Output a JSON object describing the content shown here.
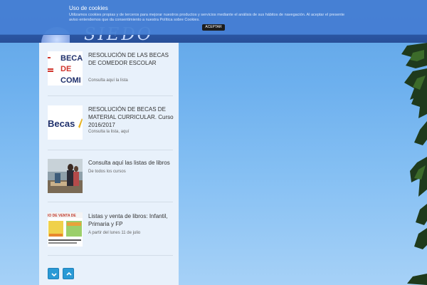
{
  "cookie": {
    "title": "Uso de cookies",
    "text": "Utilizamos cookies propias y de terceros para mejorar nuestros productos y servicios mediante el análisis de sus hábitos de navegación. Al aceptar el presente aviso entendemos que da consentimiento a nuestra Política sobre Cookies.",
    "accept_label": "ACEPTAR"
  },
  "site": {
    "logo_text": "SIEDO"
  },
  "news": [
    {
      "title": "RESOLUCIÓN DE LAS BECAS DE COMEDOR ESCOLAR",
      "subtitle": "Consulta aquí la lista",
      "thumb_lines": [
        "BECAS",
        "DE",
        "COMI"
      ]
    },
    {
      "title": "RESOLUCIÓN DE BECAS DE MATERIAL CURRICULAR. Curso 2016/2017",
      "subtitle": "Consulta la lista, aquí",
      "thumb_text": "Becas"
    },
    {
      "title": "Consulta aquí las listas de libros",
      "subtitle": "De todos los cursos"
    },
    {
      "title": "Listas y venta de libros: Infantil, Primaria y FP",
      "subtitle": "A partir del lunes 11 de julio",
      "thumb_text": "IO DE VENTA DE"
    }
  ],
  "pager": {
    "down_icon": "chevron-down-icon",
    "up_icon": "chevron-up-icon"
  },
  "colors": {
    "pager": "#2a9ad6",
    "banner": "#4882d6",
    "header": "#2c59a8"
  }
}
